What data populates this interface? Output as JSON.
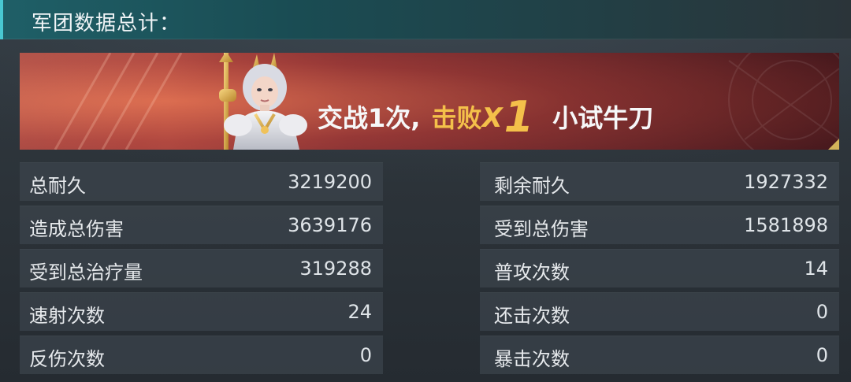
{
  "header": {
    "title": "军团数据总计："
  },
  "banner": {
    "battle_text": "交战1次,",
    "defeat_label": "击败",
    "defeat_x": "X",
    "defeat_count": "1",
    "rank_title": "小试牛刀"
  },
  "stats": {
    "rows": [
      {
        "left_label": "总耐久",
        "left_value": "3219200",
        "right_label": "剩余耐久",
        "right_value": "1927332"
      },
      {
        "left_label": "造成总伤害",
        "left_value": "3639176",
        "right_label": "受到总伤害",
        "right_value": "1581898"
      },
      {
        "left_label": "受到总治疗量",
        "left_value": "319288",
        "right_label": "普攻次数",
        "right_value": "14"
      },
      {
        "left_label": "速射次数",
        "left_value": "24",
        "right_label": "还击次数",
        "right_value": "0"
      },
      {
        "left_label": "反伤次数",
        "left_value": "0",
        "right_label": "暴击次数",
        "right_value": "0"
      }
    ]
  },
  "colors": {
    "header_accent": "#49c8d2",
    "highlight_gold": "#f4c04a",
    "banner_red": "#9a3f3f"
  }
}
